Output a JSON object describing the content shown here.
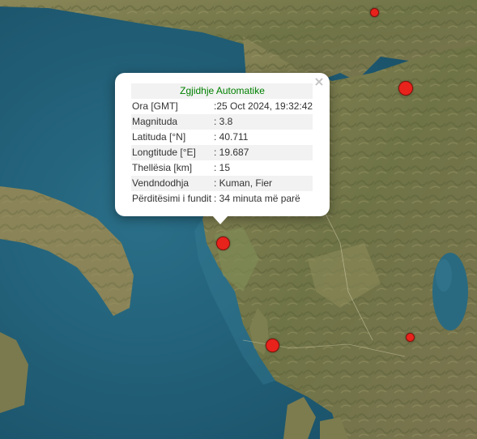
{
  "popup": {
    "title": "Zgjidhje Automatike",
    "close_symbol": "×",
    "rows": [
      {
        "label": "Ora [GMT]",
        "value": ":25 Oct 2024, 19:32:42"
      },
      {
        "label": "Magnituda",
        "value": ": 3.8"
      },
      {
        "label": "Latituda [°N]",
        "value": ": 40.711"
      },
      {
        "label": "Longtitude [°E]",
        "value": ": 19.687"
      },
      {
        "label": "Thellësia [km]",
        "value": ": 15"
      },
      {
        "label": "Vendndodhja",
        "value": ": Kuman, Fier"
      },
      {
        "label": "Përditësimi i fundit",
        "value": ": 34 minuta më parë"
      }
    ]
  },
  "colors": {
    "marker": "#e8231c",
    "title": "#008000",
    "sea": "#1e5a73",
    "land": "#7d7c4e"
  },
  "markers": [
    {
      "name": "earthquake-marker-selected"
    },
    {
      "name": "earthquake-marker"
    },
    {
      "name": "earthquake-marker"
    },
    {
      "name": "earthquake-marker"
    },
    {
      "name": "earthquake-marker"
    }
  ]
}
